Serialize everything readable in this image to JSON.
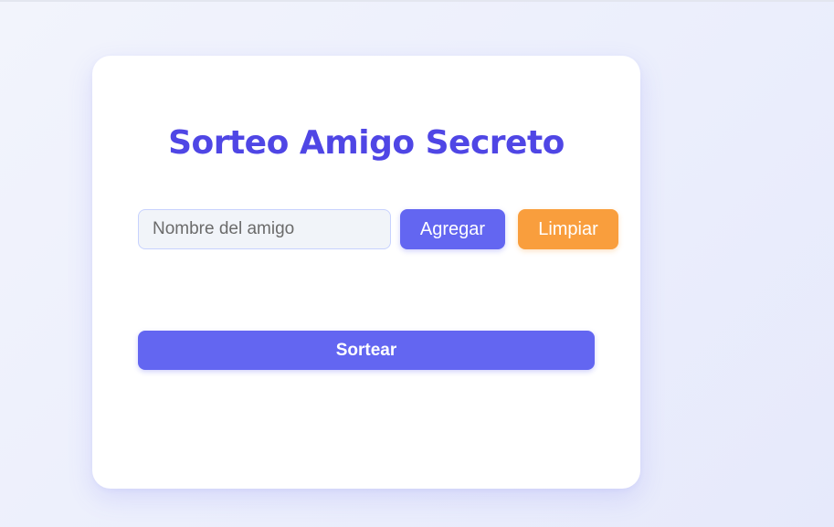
{
  "app": {
    "title": "Sorteo Amigo Secreto"
  },
  "form": {
    "input_placeholder": "Nombre del amigo",
    "input_value": "",
    "add_label": "Agregar",
    "clear_label": "Limpiar"
  },
  "actions": {
    "draw_label": "Sortear"
  },
  "friends": [],
  "result": "",
  "colors": {
    "accent": "#6366f1",
    "title": "#4f46e5",
    "clear": "#f99e3d",
    "card": "#ffffff",
    "background": "#eceffc"
  }
}
